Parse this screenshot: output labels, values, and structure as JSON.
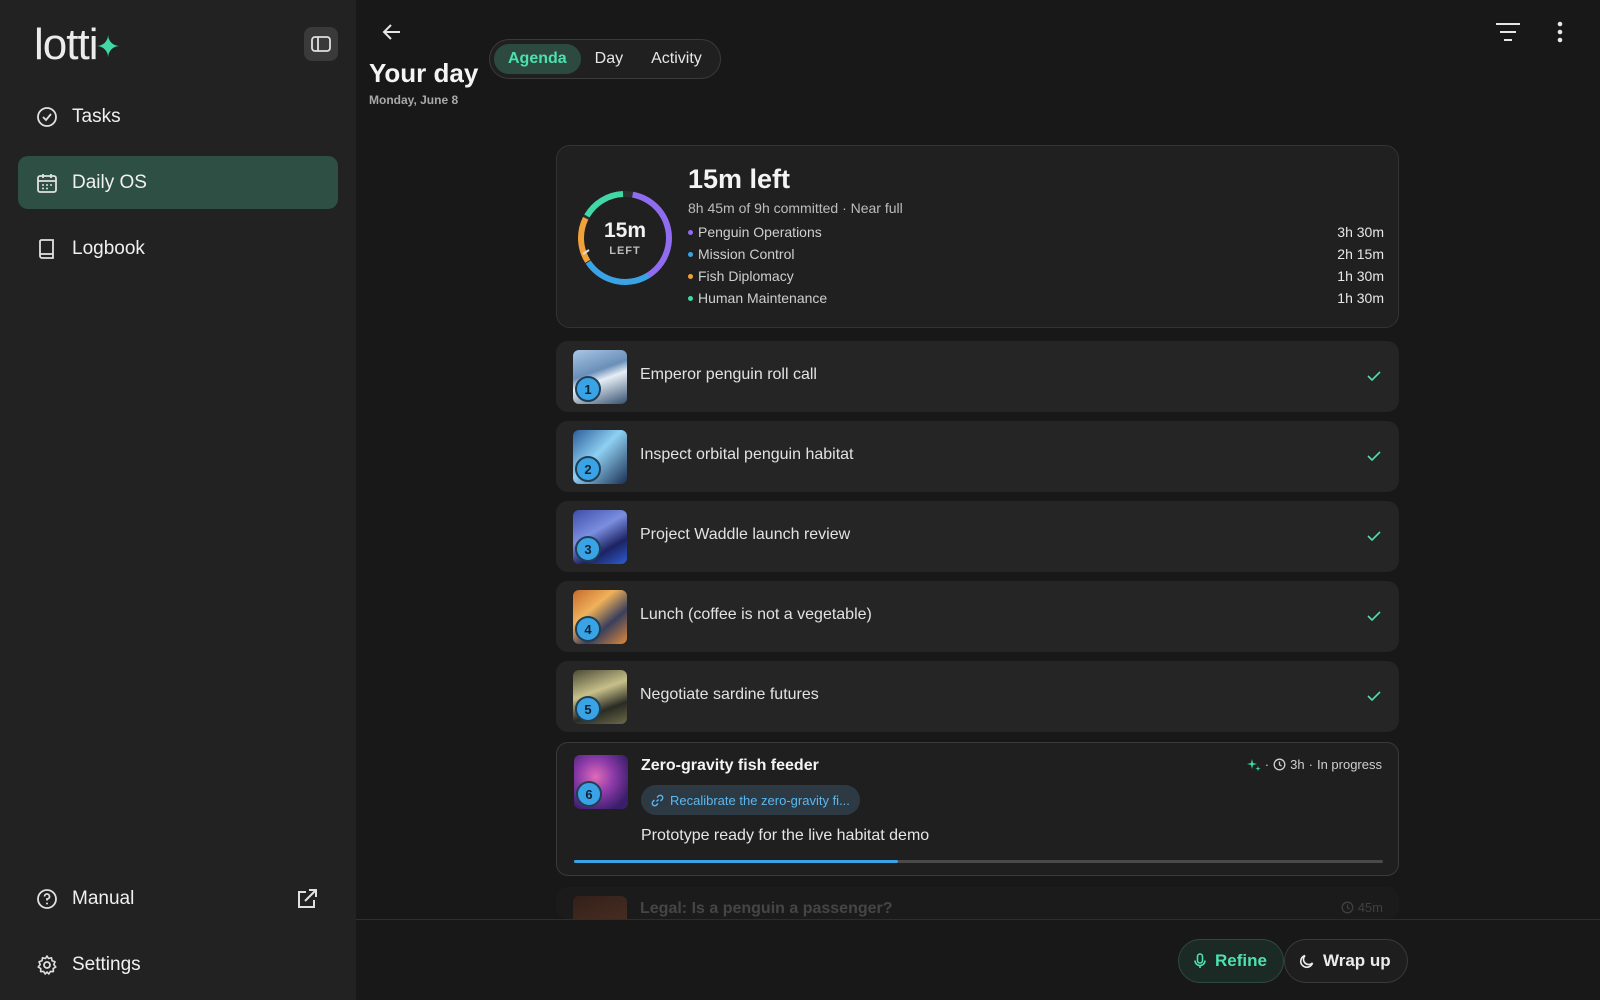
{
  "app": {
    "logo_text": "lotti",
    "logo_spark": "✦",
    "accent": "#3fd8a6"
  },
  "sidebar": {
    "items": [
      {
        "label": "Tasks",
        "icon": "check-circle-icon"
      },
      {
        "label": "Daily OS",
        "icon": "calendar-icon",
        "active": true
      },
      {
        "label": "Logbook",
        "icon": "book-icon"
      }
    ],
    "bottom": [
      {
        "label": "Manual",
        "icon": "help-circle-icon"
      },
      {
        "label": "Settings",
        "icon": "gear-icon"
      }
    ]
  },
  "header": {
    "title": "Your day",
    "date": "Monday, June 8",
    "tabs": [
      {
        "label": "Agenda",
        "active": true
      },
      {
        "label": "Day"
      },
      {
        "label": "Activity"
      }
    ]
  },
  "budget": {
    "ring_value": "15m",
    "ring_label": "LEFT",
    "headline": "15m left",
    "subtitle": "8h 45m of 9h committed · Near full",
    "categories": [
      {
        "name": "Penguin Operations",
        "duration": "3h 30m",
        "color": "#8f6cf0"
      },
      {
        "name": "Mission Control",
        "duration": "2h 15m",
        "color": "#3aa3e6"
      },
      {
        "name": "Fish Diplomacy",
        "duration": "1h 30m",
        "color": "#f0a13a"
      },
      {
        "name": "Human Maintenance",
        "duration": "1h 30m",
        "color": "#3fd8a6"
      }
    ]
  },
  "tasks": [
    {
      "n": "1",
      "title": "Emperor penguin roll call",
      "done": true
    },
    {
      "n": "2",
      "title": "Inspect orbital penguin habitat",
      "done": true
    },
    {
      "n": "3",
      "title": "Project Waddle launch review",
      "done": true
    },
    {
      "n": "4",
      "title": "Lunch (coffee is not a vegetable)",
      "done": true
    },
    {
      "n": "5",
      "title": "Negotiate sardine futures",
      "done": true
    }
  ],
  "current_task": {
    "n": "6",
    "title": "Zero-gravity fish feeder",
    "duration": "3h",
    "status": "In progress",
    "link": "Recalibrate the zero-gravity fi...",
    "description": "Prototype ready for the live habitat demo",
    "progress": 0.4
  },
  "next_task": {
    "title": "Legal: Is a penguin a passenger?",
    "duration": "45m"
  },
  "actions": {
    "refine": "Refine",
    "wrap_up": "Wrap up"
  }
}
